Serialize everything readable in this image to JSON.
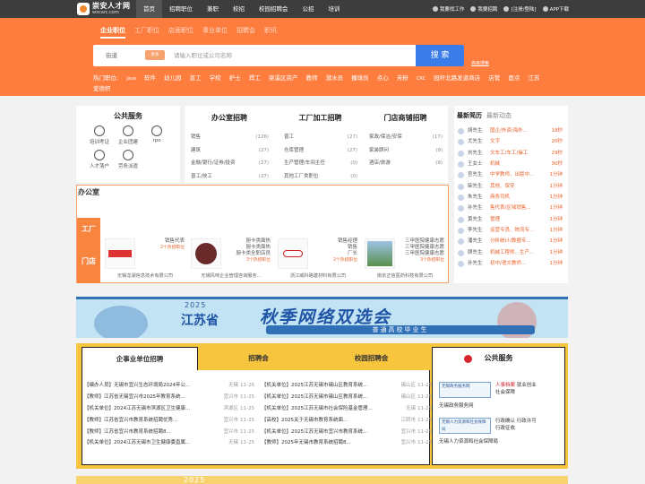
{
  "header": {
    "logo_name": "崇安人才网",
    "logo_domain": "wxcarc.com",
    "nav": [
      "首页",
      "招聘职位",
      "兼职",
      "校招",
      "校园招聘会",
      "公招",
      "培训"
    ],
    "right_links": [
      "我要找工作",
      "我要招聘",
      "[注册/登陆]",
      "APP下载"
    ]
  },
  "search": {
    "tabs": [
      "企业职位",
      "工厂职位",
      "店面职位",
      "事业单位",
      "招聘会",
      "职讯"
    ],
    "city": "街道",
    "type": "更多",
    "placeholder": "请输入职位或公司名称",
    "button": "搜 索",
    "advanced": "高级搜索",
    "hot_label": "热门职位:",
    "hot": [
      "Java",
      "软件",
      "幼儿园",
      "普工",
      "学校",
      "护士",
      "焊工",
      "梁溪区资产",
      "教师",
      "潜水员",
      "播球员",
      "点心",
      "芳粉",
      "CRC",
      "园杆北路发道商店",
      "店管",
      "面点",
      "江苏爱德积"
    ]
  },
  "public_service": {
    "title": "公共服务",
    "items": [
      "培训考证",
      "企业团建",
      "rpo",
      "人才落户",
      "劳务派遣"
    ]
  },
  "job_cats": [
    {
      "title": "办公室招聘",
      "rows": [
        {
          "n": "销售",
          "c": "(126)"
        },
        {
          "n": "建筑",
          "c": "(27)"
        },
        {
          "n": "金融/银行/证券/投资",
          "c": "(27)"
        },
        {
          "n": "普工/技工",
          "c": "(27)"
        }
      ]
    },
    {
      "title": "工厂加工招聘",
      "rows": [
        {
          "n": "普工",
          "c": "(27)"
        },
        {
          "n": "仓库管理",
          "c": "(27)"
        },
        {
          "n": "生产管理/车间主任",
          "c": "(0)"
        },
        {
          "n": "其他工厂类职位",
          "c": "(0)"
        }
      ]
    },
    {
      "title": "门店商铺招聘",
      "rows": [
        {
          "n": "家政/保洁/安保",
          "c": "(17)"
        },
        {
          "n": "家装顾问",
          "c": "(9)"
        },
        {
          "n": "酒店/旅游",
          "c": "(9)"
        }
      ]
    }
  ],
  "highlights": {
    "tabs": [
      "办公室",
      "工厂",
      "门店"
    ],
    "companies": [
      {
        "jobs": [
          "销售代表"
        ],
        "count": "2个热招职位",
        "name": "无锡龙湖信息技术有限公司"
      },
      {
        "jobs": [
          "厨卡类面热",
          "厨卡类面热",
          "厨卡类全职店员"
        ],
        "count": "3个热招职位",
        "name": "无锡风味企业管理咨询服务..."
      },
      {
        "jobs": [
          "销售经理",
          "销售",
          "厂长"
        ],
        "count": "2个热招职位",
        "name": "浙江威科路建材料有限公司"
      },
      {
        "jobs": [
          "三甲医院健康志愿",
          "三甲医院健康志愿",
          "三甲医院健康志愿"
        ],
        "count": "3个热招职位",
        "name": "南京正信医药科技有限公司"
      }
    ]
  },
  "news": {
    "tabs": [
      "最新简历",
      "最新动态"
    ],
    "rows": [
      {
        "n": "胡先生",
        "j": "国企/外资/海外...",
        "t": "18秒"
      },
      {
        "n": "尤先生",
        "j": "文字",
        "t": "20秒"
      },
      {
        "n": "刘先生",
        "j": "文车工/车工/操工",
        "t": "29秒"
      },
      {
        "n": "王女士",
        "j": "机械",
        "t": "30秒"
      },
      {
        "n": "官先生",
        "j": "中学教师、出版中...",
        "t": "1分钟"
      },
      {
        "n": "柴先生",
        "j": "其他、保安",
        "t": "1分钟"
      },
      {
        "n": "朱先生",
        "j": "商务司机",
        "t": "1分钟"
      },
      {
        "n": "孙先生",
        "j": "售代表/区域销售...",
        "t": "1分钟"
      },
      {
        "n": "黄先生",
        "j": "管理",
        "t": "1分钟"
      },
      {
        "n": "李先生",
        "j": "运营专员、物流专...",
        "t": "1分钟"
      },
      {
        "n": "潘先生",
        "j": "分析统计/数据专...",
        "t": "1分钟"
      },
      {
        "n": "顾先生",
        "j": "机械工程师、生产...",
        "t": "1分钟"
      },
      {
        "n": "孙先生",
        "j": "初中/语文教师...",
        "t": "1分钟"
      }
    ]
  },
  "ad": {
    "year": "2025",
    "province": "江苏省",
    "title": "秋季网络双选会",
    "subtitle": "普通高校毕业生"
  },
  "recruit": {
    "tabs": [
      "企事业单位招聘",
      "招聘会",
      "校园招聘会"
    ],
    "left": [
      {
        "x": "【编办人员】无锡市宜兴生态环境局2024年公...",
        "p": "无锡",
        "d": "11-26"
      },
      {
        "x": "【教师】江苏省无锡宜兴市2025年教育系统...",
        "p": "宜兴市",
        "d": "11-25"
      },
      {
        "x": "【机关单位】2024江苏无锡市滨湖区卫生健康...",
        "p": "滨湖区",
        "d": "11-25"
      },
      {
        "x": "【教师】江苏省宜兴市教育系统招聘优秀...",
        "p": "宜兴市",
        "d": "11-25"
      },
      {
        "x": "【教师】江苏省宜兴市教育系统招聘8...",
        "p": "宜兴市",
        "d": "11-25"
      },
      {
        "x": "【机关单位】2024江苏无锡市卫生健康委直属...",
        "p": "无锡",
        "d": "11-25"
      }
    ],
    "right": [
      {
        "x": "【机关单位】2025江苏无锡市锡山区教育系统...",
        "p": "锡山区",
        "d": "11-25"
      },
      {
        "x": "【机关单位】2025江苏无锡市锡山区教育系统...",
        "p": "锡山区",
        "d": "11-25"
      },
      {
        "x": "【机关单位】2025江苏无锡市社会保险基金管理...",
        "p": "无锡",
        "d": "11-25"
      },
      {
        "x": "【高校】2025关于无锡市教育系统面...",
        "p": "江阴市",
        "d": "11-25"
      },
      {
        "x": "【机关单位】2025江苏无锡市宜兴市教育系统...",
        "p": "宜兴市",
        "d": "11-25"
      },
      {
        "x": "【教师】2025年无锡市教育系统招聘8...",
        "p": "宜兴市",
        "d": "11-25"
      }
    ]
  },
  "services": {
    "title": "公共服务",
    "items": [
      {
        "logo": "无锡政务服务网",
        "tags": [
          "人事档案",
          "就业创业",
          "社会保障"
        ],
        "name": "无锡政务服务网"
      },
      {
        "logo": "无锡人力资源和社会保障局",
        "tags": [
          "行政确认",
          "行政许可",
          "行政征收"
        ],
        "name": "无锡人力资源和社会保障局"
      }
    ]
  },
  "ad2": {
    "year": "2025"
  }
}
